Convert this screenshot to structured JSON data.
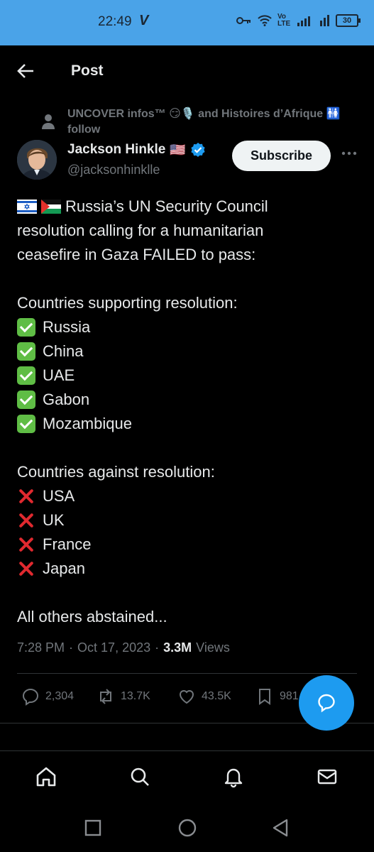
{
  "status_bar": {
    "time": "22:49",
    "carrier_mark": "V",
    "network": "Vo LTE",
    "battery": "30"
  },
  "header": {
    "title": "Post"
  },
  "social_context": {
    "text": "UNCOVER infos™ 😏🎙️ and Histoires d’Afrique 🚻 follow"
  },
  "author": {
    "name": "Jackson Hinkle",
    "flag": "🇺🇸",
    "handle": "@jacksonhinklle",
    "subscribe_label": "Subscribe"
  },
  "tweet": {
    "intro_lines": [
      "Russia’s UN Security Council",
      "resolution calling for a humanitarian",
      "ceasefire in Gaza FAILED to pass:"
    ],
    "supporting_heading": "Countries supporting resolution:",
    "supporting": [
      "Russia",
      "China",
      "UAE",
      "Gabon",
      "Mozambique"
    ],
    "against_heading": "Countries against resolution:",
    "against": [
      "USA",
      "UK",
      "France",
      "Japan"
    ],
    "closing": "All others abstained..."
  },
  "meta": {
    "time": "7:28 PM",
    "date": "Oct 17, 2023",
    "views_count": "3.3M",
    "views_label": "Views"
  },
  "actions": {
    "replies": "2,304",
    "reposts": "13.7K",
    "likes": "43.5K",
    "bookmarks": "981"
  },
  "colors": {
    "accent": "#1d9bf0",
    "status_bar": "#4aa3e8",
    "check": "#5fbd45",
    "cross": "#e0292f"
  }
}
